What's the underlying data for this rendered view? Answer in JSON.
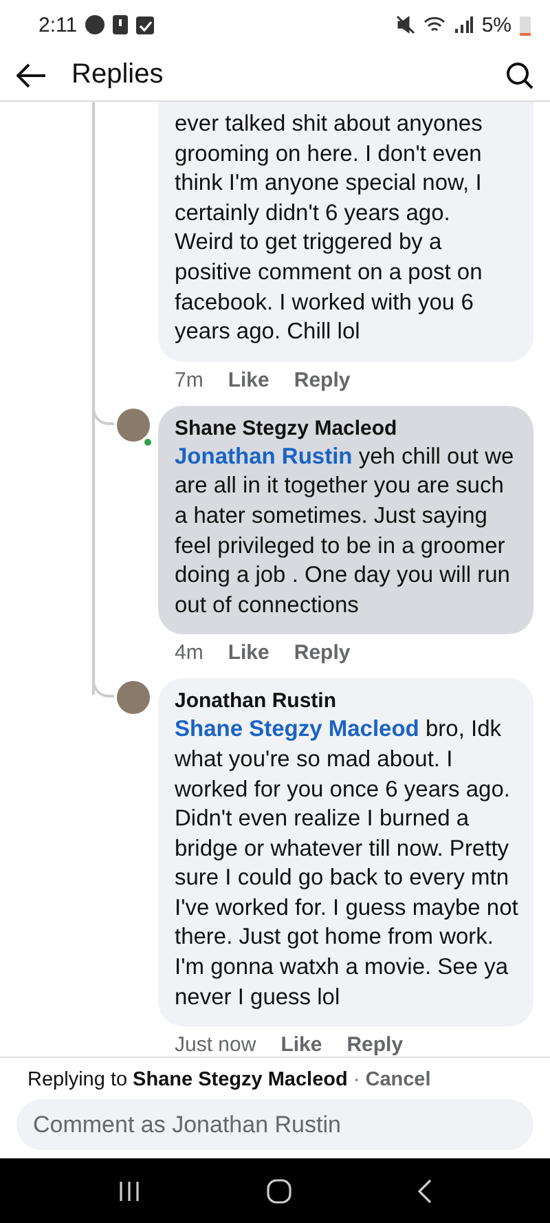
{
  "status_bar": {
    "time": "2:11",
    "battery": "5%"
  },
  "header": {
    "title": "Replies"
  },
  "comments": [
    {
      "text": "ever talked shit about anyones grooming on here. I don't even think I'm anyone special now, I certainly didn't 6 years ago. Weird to get triggered by a positive comment on a post on facebook. I worked with you 6 years ago.  Chill lol",
      "time": "7m",
      "like": "Like",
      "reply": "Reply",
      "highlighted": false,
      "online": false,
      "cut_top": true
    },
    {
      "author": "Shane Stegzy Macleod",
      "mention": "Jonathan Rustin",
      "text": "yeh chill out we are all in it together you are such a hater sometimes. Just saying feel privileged to be in a groomer doing a job . One day you will run out of connections",
      "time": "4m",
      "like": "Like",
      "reply": "Reply",
      "highlighted": true,
      "online": true,
      "cut_top": false
    },
    {
      "author": "Jonathan Rustin",
      "mention": "Shane Stegzy Macleod",
      "text": "bro, Idk what you're so mad about. I worked for you once 6 years ago. Didn't even realize I burned a bridge or whatever till now. Pretty sure I could go back to every mtn I've worked for. I guess maybe not there.  Just got home from work. I'm gonna watxh a movie. See ya never I guess lol",
      "time": "Just now",
      "like": "Like",
      "reply": "Reply",
      "highlighted": false,
      "online": false,
      "cut_top": false
    }
  ],
  "replying": {
    "prefix": "Replying to",
    "name": "Shane Stegzy Macleod",
    "separator": "·",
    "cancel": "Cancel"
  },
  "composer": {
    "placeholder": "Comment as Jonathan Rustin"
  }
}
